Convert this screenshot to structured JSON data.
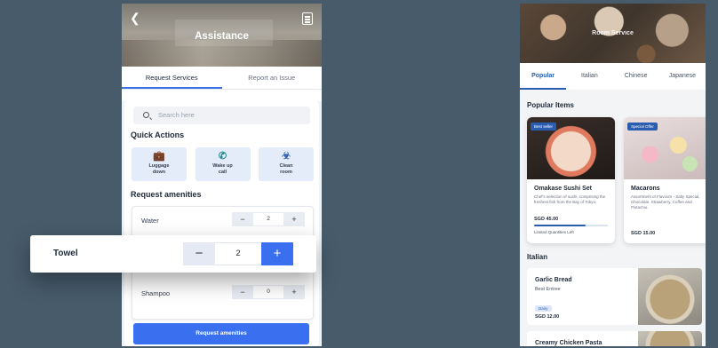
{
  "assistance": {
    "title": "Assistance",
    "tabs": [
      {
        "label": "Request Services",
        "active": true
      },
      {
        "label": "Report an Issue",
        "active": false
      }
    ],
    "search_placeholder": "Search here",
    "quick_actions_title": "Quick Actions",
    "quick_actions": [
      {
        "label_line1": "Luggage",
        "label_line2": "down",
        "icon": "luggage-icon"
      },
      {
        "label_line1": "Wake up",
        "label_line2": "call",
        "icon": "phone-icon"
      },
      {
        "label_line1": "Clean",
        "label_line2": "room",
        "icon": "broom-icon"
      }
    ],
    "amenities_title": "Request amenities",
    "amenities": [
      {
        "name": "Water",
        "qty": "2"
      },
      {
        "name": "Shampoo",
        "qty": "0"
      }
    ],
    "request_button": "Request amenities",
    "accent_color": "#3a6ff0"
  },
  "towel_row": {
    "name": "Towel",
    "qty": "2",
    "minus": "−",
    "plus": "+"
  },
  "room_service": {
    "title": "Room Service",
    "tabs": [
      {
        "label": "Popular",
        "active": true
      },
      {
        "label": "Italian",
        "active": false
      },
      {
        "label": "Chinese",
        "active": false
      },
      {
        "label": "Japanese",
        "active": false
      }
    ],
    "popular_title": "Popular Items",
    "popular_items": [
      {
        "badge": "Best seller",
        "name": "Omakase Sushi Set",
        "desc": "Chef's selection of sushi, comprising the freshest fish from the Bay of Tokyo.",
        "price": "SGD 45.00",
        "limited": "Limited Quantities Left",
        "remaining_fraction": 0.7
      },
      {
        "badge": "Special Offer",
        "name": "Macarons",
        "desc": "Assortment of Flavours - Salty Special, Chocolate, Strawberry, Coffee and Pistachio.",
        "price": "SGD 15.00"
      }
    ],
    "italian_title": "Italian",
    "italian_items": [
      {
        "name": "Garlic Bread",
        "sub": "Best Entree",
        "tag": "Dairy",
        "price": "SGD 12.00"
      },
      {
        "name": "Creamy Chicken Pasta"
      }
    ],
    "accent_color": "#2a5db0"
  }
}
